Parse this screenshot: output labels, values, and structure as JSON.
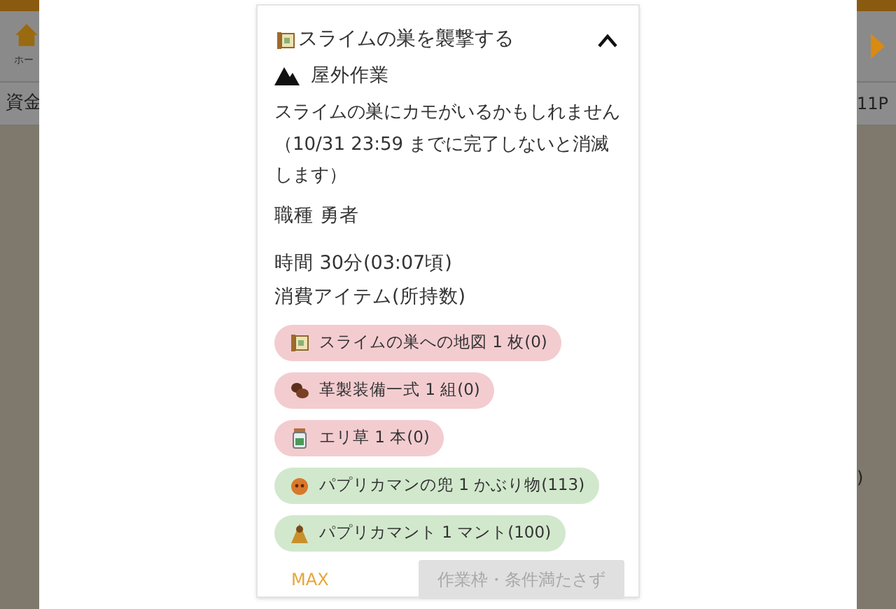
{
  "background": {
    "left_labels": [
      "ホー",
      "資金"
    ],
    "right_labels": [
      "11P",
      ")"
    ]
  },
  "task": {
    "title": "スライムの巣を襲撃する",
    "expanded": true,
    "category": "屋外作業",
    "description": "スライムの巣にカモがいるかもしれません（10/31 23:59 までに完了しないと消滅します）",
    "job": "職種 勇者",
    "time": "時間 30分(03:07頃)",
    "items_heading": "消費アイテム(所持数)",
    "items": [
      {
        "kind": "scroll",
        "label": "スライムの巣への地図 1 枚(0)",
        "sufficient": false
      },
      {
        "kind": "leather",
        "label": "革製装備一式 1 組(0)",
        "sufficient": false
      },
      {
        "kind": "jar",
        "label": "エリ草 1 本(0)",
        "sufficient": false
      },
      {
        "kind": "mask",
        "label": "パプリカマンの兜 1 かぶり物(113)",
        "sufficient": true
      },
      {
        "kind": "cape",
        "label": "パプリカマント 1 マント(100)",
        "sufficient": true
      }
    ],
    "max_label": "MAX",
    "submit": {
      "label": "作業枠・条件満たさず",
      "disabled": true
    }
  }
}
